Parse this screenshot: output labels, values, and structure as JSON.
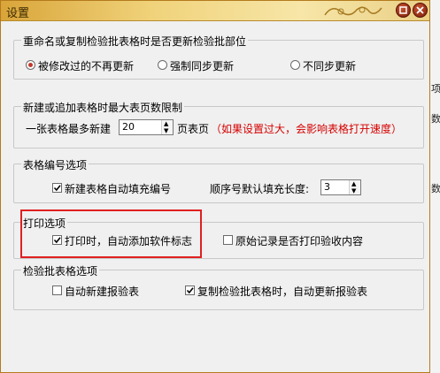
{
  "window": {
    "title": "设置"
  },
  "group_rename": {
    "legend": "重命名或复制检验批表格时是否更新检验批部位",
    "options": [
      {
        "label": "被修改过的不再更新",
        "selected": true
      },
      {
        "label": "强制同步更新",
        "selected": false
      },
      {
        "label": "不同步更新",
        "selected": false
      }
    ]
  },
  "group_pages": {
    "legend": "新建或追加表格时最大表页数限制",
    "prefix": "一张表格最多新建",
    "value": "20",
    "suffix": "页表页",
    "warning": "（如果设置过大，会影响表格打开速度）"
  },
  "group_numbering": {
    "legend": "表格编号选项",
    "auto_fill_label": "新建表格自动填充编号",
    "auto_fill_checked": true,
    "seq_label": "顺序号默认填充长度:",
    "seq_value": "3"
  },
  "group_print": {
    "legend": "打印选项",
    "add_logo_label": "打印时，自动添加软件标志",
    "add_logo_checked": true,
    "print_original_label": "原始记录是否打印验收内容",
    "print_original_checked": false
  },
  "group_inspection": {
    "legend": "检验批表格选项",
    "auto_create_label": "自动新建报验表",
    "auto_create_checked": false,
    "copy_update_label": "复制检验批表格时，自动更新报验表",
    "copy_update_checked": true
  },
  "background_glyphs": [
    "项",
    "数",
    "数"
  ],
  "colors": {
    "titlebar_gold": "#f0d27a",
    "warning_red": "#d60000",
    "highlight_red": "#e02020",
    "radio_dot": "#c0392b"
  }
}
